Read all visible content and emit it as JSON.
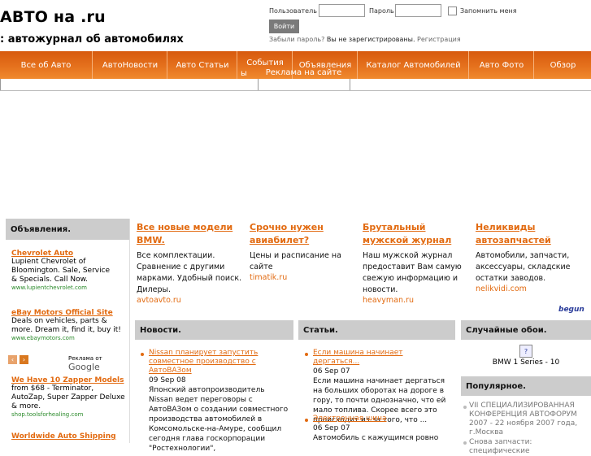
{
  "header": {
    "title": "АВТО на .ru",
    "slogan": ": автожурнал об автомобилях"
  },
  "login": {
    "user_label": "Пользователь",
    "password_label": "Пароль",
    "remember_label": "Запомнить меня",
    "submit_label": "Войти",
    "forgot_label": "Забыли пароль?",
    "not_registered_label": "Вы не зарегистрированы.",
    "register_label": "Регистрация"
  },
  "nav": {
    "items": [
      "Все об Авто",
      "АвтоНовости",
      "Авто Статьи",
      "События",
      "Объявления",
      "Каталог Автомобилей",
      "Авто Фото",
      "Обзор"
    ],
    "events_wrap": "ы",
    "advert_label": "Реклама на сайте"
  },
  "sidebar": {
    "header": "Объявления.",
    "ads": [
      {
        "title": "Chevrolet Auto",
        "text": "Lupient Chevrolet of Bloomington. Sale, Service & Specials. Call Now.",
        "url": "www.lupientchevrolet.com"
      },
      {
        "title": "eBay Motors Official Site",
        "text": "Deals on vehicles, parts & more. Dream it, find it, buy it!",
        "url": "www.ebaymotors.com"
      },
      {
        "title": "We Have 10 Zapper Models",
        "text": "from $68 - Terminator, AutoZap, Super Zapper Deluxe & more.",
        "url": "shop.toolsforhealing.com"
      },
      {
        "title": "Worldwide Auto Shipping",
        "text": "",
        "url": ""
      }
    ],
    "ads_by": "Реклама от",
    "google": "Google"
  },
  "top_ads": [
    {
      "title": "Все новые модели BMW.",
      "text": "Все комплектации. Сравнение с другими марками. Удобный поиск. Дилеры.",
      "url": "avtoavto.ru"
    },
    {
      "title": "Срочно нужен авиабилет?",
      "text": "Цены и расписание на сайте",
      "url": "timatik.ru"
    },
    {
      "title": "Брутальный мужской журнал",
      "text": "Наш мужской журнал предоставит Вам самую свежую информацию и новости.",
      "url": "heavyman.ru"
    },
    {
      "title": "Неликвиды автозапчастей",
      "text": "Автомобили, запчасти, аксессуары, складские остатки заводов.",
      "url": "nelikvidi.com"
    }
  ],
  "top_ads_brand": "begun",
  "news": {
    "header": "Новости.",
    "items": [
      {
        "title": "Nissan планирует запустить совместное производство с АвтоВАЗом",
        "date": "09 Sep 08",
        "text": "Японский автопроизводитель Nissan ведет переговоры с АвтоВАЗом о создании совместного производства автомобилей в Комсомольске-на-Амуре, сообщил сегодня глава госкорпорации \"Ростехнологии\","
      }
    ]
  },
  "articles": {
    "header": "Статьи.",
    "items": [
      {
        "title": "Если машина начинает дергаться...",
        "date": "06 Sep 07",
        "text": "Если машина начинает дергаться на больших оборотах на дороге в гору, то почти однозначно, что ей мало топлива. Скорее всего это происходит из-за того, что ..."
      },
      {
        "title": "Электронная шина",
        "date": "06 Sep 07",
        "text": "Автомобиль с кажущимся ровно"
      }
    ]
  },
  "random_photos": {
    "header": "Случайные обои.",
    "caption": "BMW 1 Series - 10",
    "icon": "broken-image-icon"
  },
  "popular": {
    "header": "Популярное.",
    "items": [
      "VII СПЕЦИАЛИЗИРОВАННАЯ КОНФЕРЕНЦИЯ АВТОФОРУМ 2007 - 22 ноября 2007 года, г.Москва",
      "Снова запчасти: специфические"
    ]
  },
  "colors": {
    "accent": "#e26a10",
    "nav_gradient_top": "#d75a0e",
    "panel_header": "#cccccc"
  }
}
